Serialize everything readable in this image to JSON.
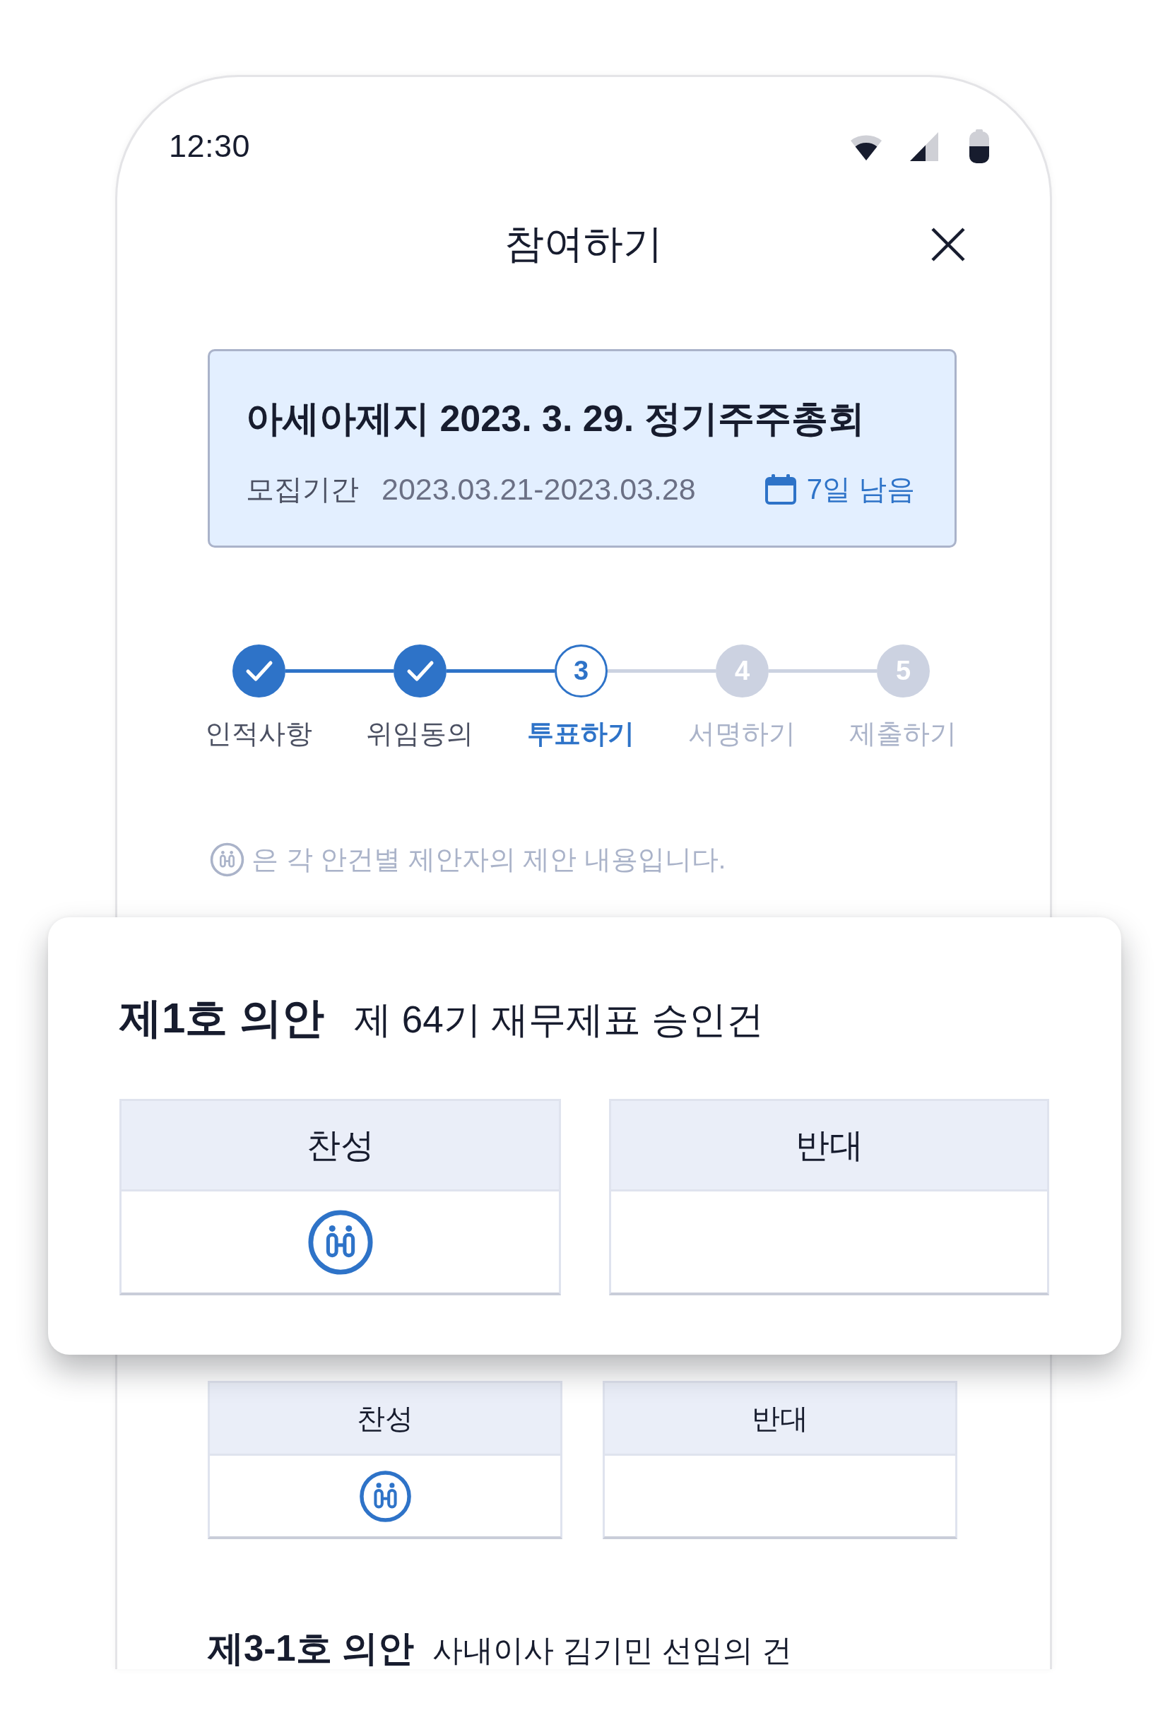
{
  "status_bar": {
    "time": "12:30"
  },
  "header": {
    "title": "참여하기"
  },
  "meeting": {
    "title": "아세아제지 2023. 3. 29. 정기주주총회",
    "period_label": "모집기간",
    "period": "2023.03.21-2023.03.28",
    "remaining": "7일 남음"
  },
  "steps": [
    {
      "label": "인적사항",
      "completed": true,
      "selected": false
    },
    {
      "label": "위임동의",
      "completed": true,
      "selected": false
    },
    {
      "number": "3",
      "label": "투표하기",
      "completed": false,
      "selected": true
    },
    {
      "number": "4",
      "label": "서명하기",
      "completed": false,
      "selected": false
    },
    {
      "number": "5",
      "label": "제출하기",
      "completed": false,
      "selected": false
    }
  ],
  "note": {
    "text": "은 각 안건별 제안자의 제안 내용입니다."
  },
  "vote_options": [
    {
      "label": "찬성",
      "proposed": true
    },
    {
      "label": "반대",
      "proposed": false
    }
  ],
  "next_agenda": {
    "number": "제3-1호 의안",
    "title": "사내이사 김기민 선임의 건"
  },
  "callout": {
    "number": "제1호 의안",
    "title": "제 64기 재무제표 승인건",
    "options": [
      {
        "label": "찬성",
        "proposed": true
      },
      {
        "label": "반대",
        "proposed": false
      }
    ]
  }
}
